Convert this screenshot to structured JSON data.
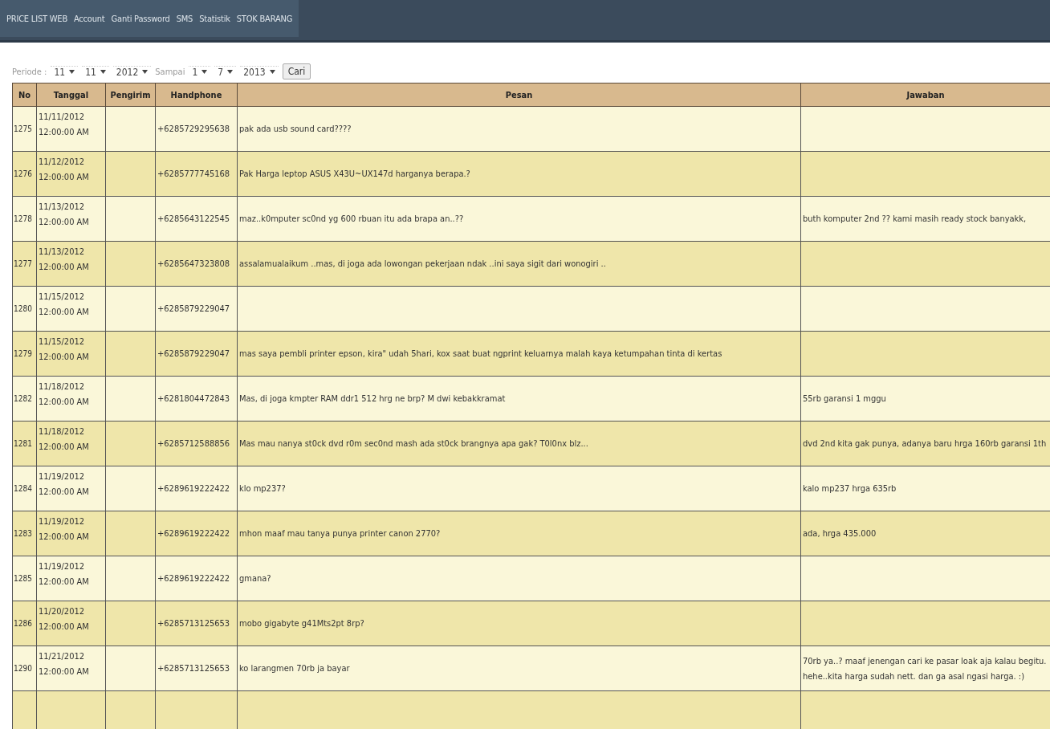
{
  "nav": {
    "items": [
      "PRICE LIST WEB",
      "Account",
      "Ganti Password",
      "SMS",
      "Statistik",
      "STOK BARANG"
    ]
  },
  "filter": {
    "label": "Periode :",
    "from": [
      "11",
      "11",
      "2012"
    ],
    "separator": "Sampai",
    "to": [
      "1",
      "7",
      "2013"
    ],
    "button": "Cari"
  },
  "table": {
    "columns": [
      "No",
      "Tanggal",
      "Pengirim",
      "Handphone",
      "Pesan",
      "Jawaban"
    ],
    "rows": [
      {
        "no": "1275",
        "date": "11/11/2012",
        "time": "12:00:00 AM",
        "phone": "+6285729295638",
        "message": "pak ada usb sound card????",
        "answer": ""
      },
      {
        "no": "1276",
        "date": "11/12/2012",
        "time": "12:00:00 AM",
        "phone": "+6285777745168",
        "message": "Pak Harga leptop ASUS X43U~UX147d harganya berapa.?",
        "answer": ""
      },
      {
        "no": "1278",
        "date": "11/13/2012",
        "time": "12:00:00 AM",
        "phone": "+6285643122545",
        "message": "maz..k0mputer sc0nd yg 600 rbuan itu ada brapa an..??",
        "answer": "buth komputer 2nd ?? kami masih ready stock banyakk,"
      },
      {
        "no": "1277",
        "date": "11/13/2012",
        "time": "12:00:00 AM",
        "phone": "+6285647323808",
        "message": "assalamualaikum ..mas, di joga ada lowongan pekerjaan ndak ..ini saya sigit dari wonogiri ..",
        "answer": ""
      },
      {
        "no": "1280",
        "date": "11/15/2012",
        "time": "12:00:00 AM",
        "phone": "+6285879229047",
        "message": "",
        "answer": ""
      },
      {
        "no": "1279",
        "date": "11/15/2012",
        "time": "12:00:00 AM",
        "phone": "+6285879229047",
        "message": "mas saya pembli printer epson, kira\" udah 5hari, kox saat buat ngprint keluarnya malah kaya ketumpahan tinta di kertas",
        "answer": ""
      },
      {
        "no": "1282",
        "date": "11/18/2012",
        "time": "12:00:00 AM",
        "phone": "+6281804472843",
        "message": "Mas, di joga kmpter RAM ddr1 512 hrg ne brp? M dwi kebakkramat",
        "answer": "55rb garansi 1 mggu"
      },
      {
        "no": "1281",
        "date": "11/18/2012",
        "time": "12:00:00 AM",
        "phone": "+6285712588856",
        "message": "Mas mau nanya st0ck dvd r0m sec0nd mash ada st0ck brangnya apa gak? T0l0nx blz...",
        "answer": "dvd 2nd kita gak punya, adanya baru hrga 160rb garansi 1th"
      },
      {
        "no": "1284",
        "date": "11/19/2012",
        "time": "12:00:00 AM",
        "phone": "+6289619222422",
        "message": "klo mp237?",
        "answer": "kalo mp237 hrga 635rb"
      },
      {
        "no": "1283",
        "date": "11/19/2012",
        "time": "12:00:00 AM",
        "phone": "+6289619222422",
        "message": "mhon maaf mau tanya punya printer canon 2770?",
        "answer": "ada, hrga 435.000"
      },
      {
        "no": "1285",
        "date": "11/19/2012",
        "time": "12:00:00 AM",
        "phone": "+6289619222422",
        "message": "gmana?",
        "answer": ""
      },
      {
        "no": "1286",
        "date": "11/20/2012",
        "time": "12:00:00 AM",
        "phone": "+6285713125653",
        "message": "mobo gigabyte g41Mts2pt 8rp?",
        "answer": ""
      },
      {
        "no": "1290",
        "date": "11/21/2012",
        "time": "12:00:00 AM",
        "phone": "+6285713125653",
        "message": "ko larangmen 70rb ja bayar",
        "answer": "70rb ya..? maaf jenengan cari ke pasar loak aja kalau begitu. hehe..kita harga sudah nett. dan ga asal ngasi harga. :)"
      }
    ]
  }
}
